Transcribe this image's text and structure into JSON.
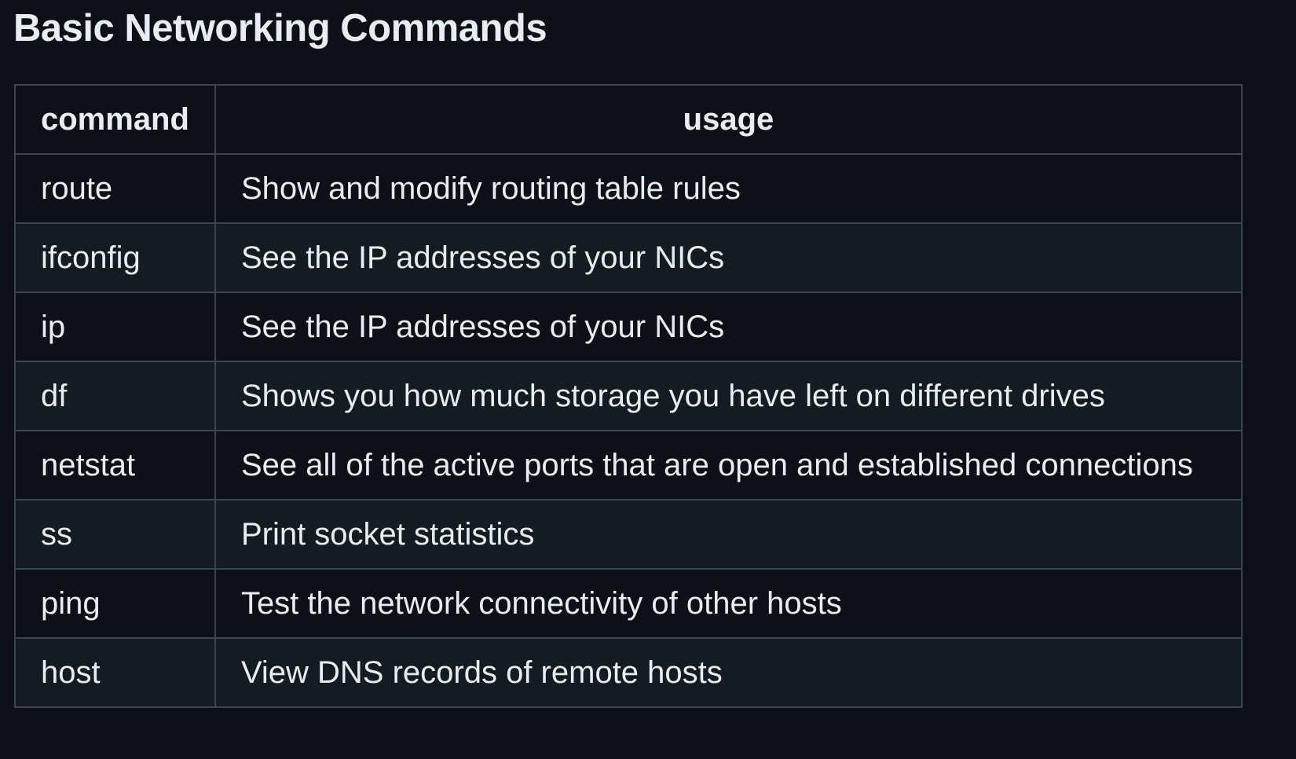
{
  "page": {
    "title": "Basic Networking Commands"
  },
  "table": {
    "headers": {
      "command": "command",
      "usage": "usage"
    },
    "rows": [
      {
        "command": "route",
        "usage": "Show and modify routing table rules"
      },
      {
        "command": "ifconfig",
        "usage": "See the IP addresses of your NICs"
      },
      {
        "command": "ip",
        "usage": "See the IP addresses of your NICs"
      },
      {
        "command": "df",
        "usage": "Shows you how much storage you have left on different drives"
      },
      {
        "command": "netstat",
        "usage": "See all of the active ports that are open and established connections"
      },
      {
        "command": "ss",
        "usage": "Print socket statistics"
      },
      {
        "command": "ping",
        "usage": "Test the network connectivity of other hosts"
      },
      {
        "command": "host",
        "usage": "View DNS records of remote hosts"
      }
    ]
  },
  "colors": {
    "background": "#0d1117",
    "row_alt": "#151b23",
    "border": "#3d444d",
    "text": "#e6edf3"
  }
}
